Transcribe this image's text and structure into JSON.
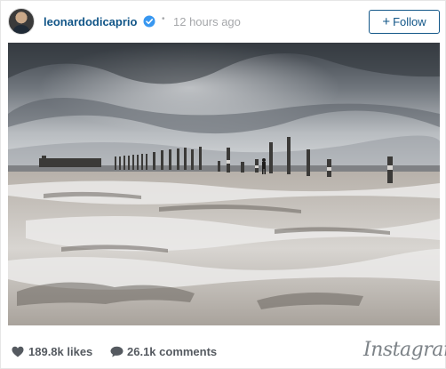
{
  "post": {
    "username": "leonardodicaprio",
    "separator": "•",
    "time_ago": "12 hours ago",
    "follow_label": "Follow",
    "follow_icon": "plus-icon",
    "verified_icon": "verified-badge-icon",
    "photo_subject": "salt flats with distant pier pilings under stormy sky"
  },
  "stats": {
    "likes": "189.8k likes",
    "comments": "26.1k comments",
    "likes_icon": "heart-icon",
    "comments_icon": "speech-bubble-icon"
  },
  "branding": {
    "logo_text": "Instagram"
  },
  "colors": {
    "link_blue": "#125688",
    "muted_gray": "#a5a7aa",
    "verified_blue": "#3897f0",
    "stats_gray": "#555a60"
  }
}
